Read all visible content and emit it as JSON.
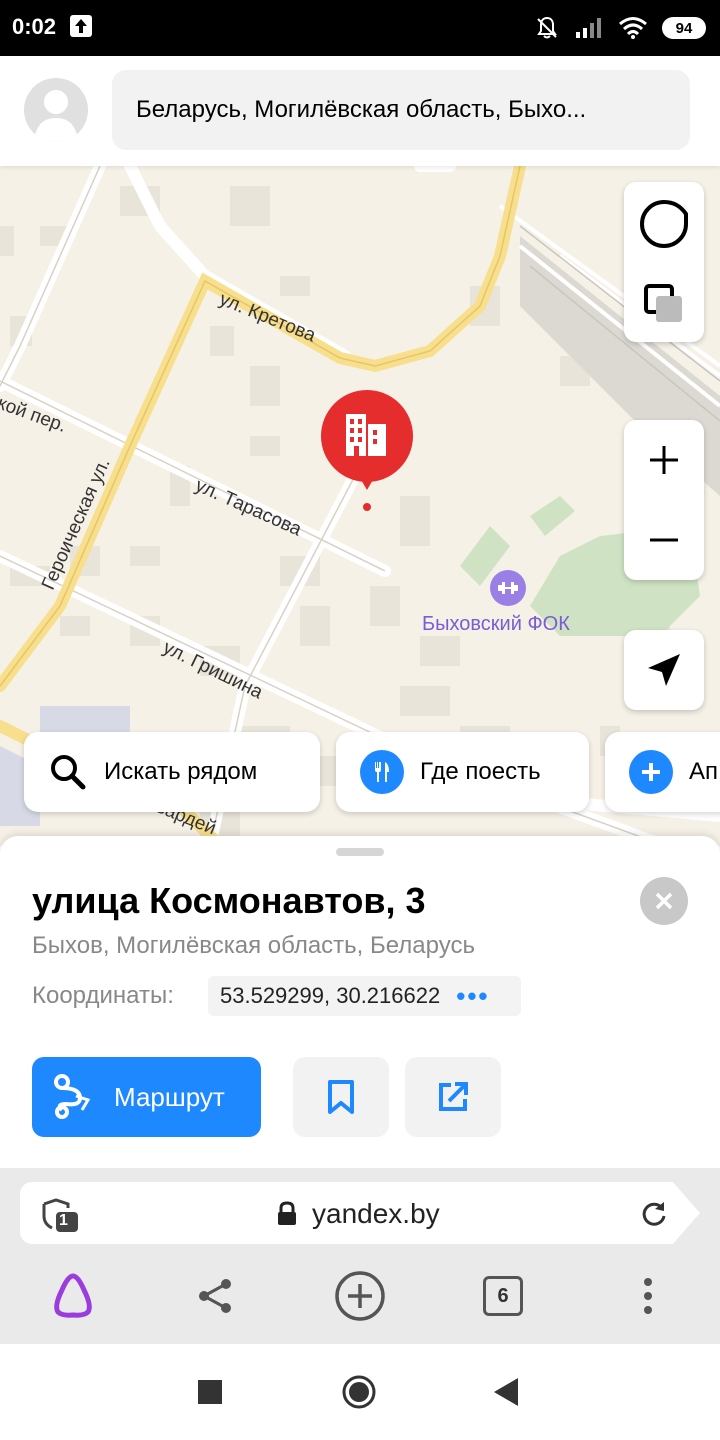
{
  "status_bar": {
    "time": "0:02",
    "battery": "94"
  },
  "search": {
    "address": "Беларусь, Могилёвская область, Быхо..."
  },
  "map": {
    "street_labels": {
      "kretova": "ул. Кретова",
      "pereulok": "кой пер.",
      "geroicheskaya": "Героическая ул.",
      "tarasova": "ул. Тарасова",
      "grishina": "ул. Гришина",
      "gvardeyskaya": "Гвардей"
    },
    "poi": {
      "name": "Быховский ФОК"
    }
  },
  "chips": [
    {
      "label": "Искать рядом",
      "icon": "search-icon"
    },
    {
      "label": "Где поесть",
      "icon": "fork-knife-icon"
    },
    {
      "label": "Ап",
      "icon": "plus-icon"
    }
  ],
  "card": {
    "title": "улица Космонавтов, 3",
    "subtitle": "Быхов, Могилёвская область, Беларусь",
    "coords_label": "Координаты:",
    "coords_value": "53.529299, 30.216622",
    "route_label": "Маршрут"
  },
  "browser": {
    "url": "yandex.by",
    "tab_count": "6",
    "shield_count": "1"
  },
  "colors": {
    "accent": "#1e88ff",
    "pin": "#e62d2d",
    "poi": "#7a5cd6",
    "alice": "#9b3ddc"
  }
}
